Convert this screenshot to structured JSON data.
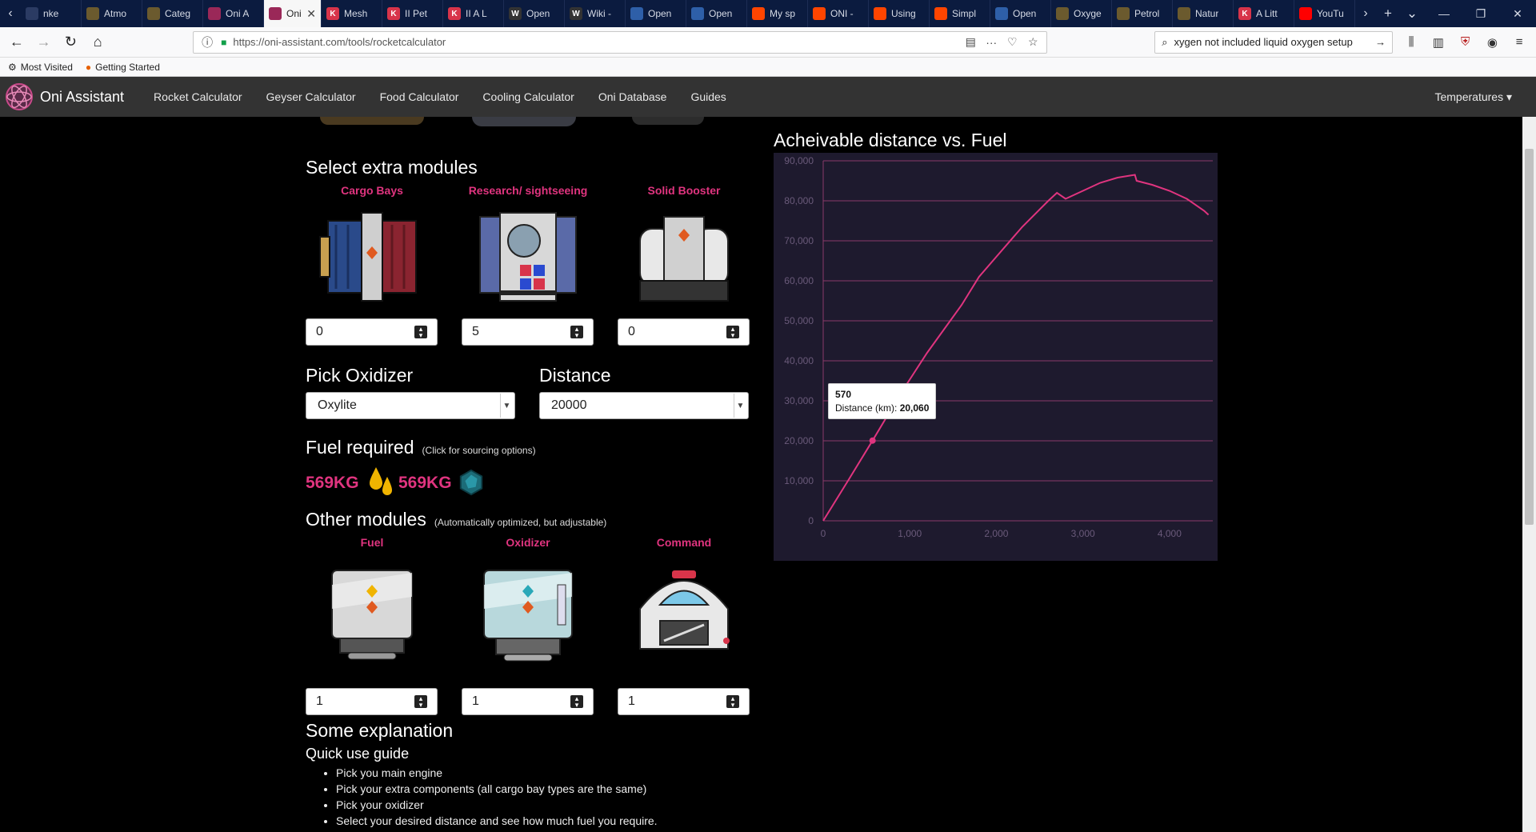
{
  "browser": {
    "tabs": [
      {
        "label": "nke",
        "icon_color": "#2b3b63",
        "icon_text": ""
      },
      {
        "label": "Atmo",
        "icon_color": "#6b5a2e",
        "icon_text": ""
      },
      {
        "label": "Categ",
        "icon_color": "#6b5a2e",
        "icon_text": ""
      },
      {
        "label": "Oni A",
        "icon_color": "#9a2858",
        "icon_text": ""
      },
      {
        "label": "Oni A",
        "icon_color": "#9a2858",
        "icon_text": ""
      },
      {
        "label": "Mesh",
        "icon_color": "#d8344a",
        "icon_text": "K"
      },
      {
        "label": "II Pet",
        "icon_color": "#d8344a",
        "icon_text": "K"
      },
      {
        "label": "II A L",
        "icon_color": "#d8344a",
        "icon_text": "K"
      },
      {
        "label": "Open",
        "icon_color": "#333333",
        "icon_text": "W"
      },
      {
        "label": "Wiki -",
        "icon_color": "#333333",
        "icon_text": "W"
      },
      {
        "label": "Open",
        "icon_color": "#2e5fa8",
        "icon_text": ""
      },
      {
        "label": "Open",
        "icon_color": "#2e5fa8",
        "icon_text": ""
      },
      {
        "label": "My sp",
        "icon_color": "#ff4500",
        "icon_text": ""
      },
      {
        "label": "ONI -",
        "icon_color": "#ff4500",
        "icon_text": ""
      },
      {
        "label": "Using",
        "icon_color": "#ff4500",
        "icon_text": ""
      },
      {
        "label": "Simpl",
        "icon_color": "#ff4500",
        "icon_text": ""
      },
      {
        "label": "Open",
        "icon_color": "#2e5fa8",
        "icon_text": ""
      },
      {
        "label": "Oxyge",
        "icon_color": "#6b5a2e",
        "icon_text": ""
      },
      {
        "label": "Petrol",
        "icon_color": "#6b5a2e",
        "icon_text": ""
      },
      {
        "label": "Natur",
        "icon_color": "#6b5a2e",
        "icon_text": ""
      },
      {
        "label": "A Litt",
        "icon_color": "#d8344a",
        "icon_text": "K"
      },
      {
        "label": "YouTu",
        "icon_color": "#ff0000",
        "icon_text": ""
      }
    ],
    "url": "https://oni-assistant.com/tools/rocketcalculator",
    "search": "xygen not included liquid oxygen setup",
    "bookmarks": [
      "Most Visited",
      "Getting Started"
    ]
  },
  "site": {
    "brand": "Oni Assistant",
    "nav": [
      "Rocket Calculator",
      "Geyser Calculator",
      "Food Calculator",
      "Cooling Calculator",
      "Oni Database",
      "Guides"
    ],
    "temperatures": "Temperatures"
  },
  "extra_modules": {
    "heading": "Select extra modules",
    "items": [
      {
        "label": "Cargo Bays",
        "value": "0"
      },
      {
        "label": "Research/ sightseeing",
        "value": "5"
      },
      {
        "label": "Solid Booster",
        "value": "0"
      }
    ]
  },
  "oxidizer": {
    "heading": "Pick Oxidizer",
    "value": "Oxylite"
  },
  "distance": {
    "heading": "Distance",
    "value": "20000"
  },
  "fuel_required": {
    "heading": "Fuel required",
    "note": "(Click for sourcing options)",
    "amount_1": "569KG",
    "amount_2": "569KG"
  },
  "other_modules": {
    "heading": "Other modules",
    "note": "(Automatically optimized, but adjustable)",
    "items": [
      {
        "label": "Fuel",
        "value": "1"
      },
      {
        "label": "Oxidizer",
        "value": "1"
      },
      {
        "label": "Command",
        "value": "1"
      }
    ]
  },
  "explanation": {
    "heading": "Some explanation",
    "subheading": "Quick use guide",
    "steps": [
      "Pick you main engine",
      "Pick your extra components (all cargo bay types are the same)",
      "Pick your oxidizer",
      "Select your desired distance and see how much fuel you require."
    ]
  },
  "colors": {
    "accent": "#e0347f",
    "chart_bg": "#1e1a2e",
    "grid": "#8a3a6a"
  },
  "chart_data": {
    "type": "line",
    "title": "Acheivable distance vs. Fuel",
    "xlabel": "",
    "ylabel": "",
    "xlim": [
      0,
      4500
    ],
    "ylim": [
      0,
      90000
    ],
    "x_ticks": [
      0,
      1000,
      2000,
      3000,
      4000
    ],
    "x_tick_labels": [
      "0",
      "1,000",
      "2,000",
      "3,000",
      "4,000"
    ],
    "y_ticks": [
      0,
      10000,
      20000,
      30000,
      40000,
      50000,
      60000,
      70000,
      80000,
      90000
    ],
    "y_tick_labels": [
      "0",
      "10,000",
      "20,000",
      "30,000",
      "40,000",
      "50,000",
      "60,000",
      "70,000",
      "80,000",
      "90,000"
    ],
    "grid": true,
    "series": [
      {
        "name": "Distance (km)",
        "x": [
          0,
          300,
          570,
          900,
          1200,
          1600,
          1800,
          2000,
          2300,
          2600,
          2700,
          2800,
          3000,
          3200,
          3400,
          3600,
          3620,
          3800,
          4000,
          4200,
          4400,
          4450
        ],
        "y": [
          0,
          10500,
          20060,
          32000,
          42000,
          54000,
          61000,
          66000,
          73500,
          80000,
          82000,
          80500,
          82500,
          84500,
          85800,
          86500,
          85000,
          84000,
          82500,
          80500,
          77500,
          76500
        ]
      }
    ],
    "tooltip": {
      "x": 570,
      "label": "Distance (km)",
      "value": "20,060"
    }
  }
}
